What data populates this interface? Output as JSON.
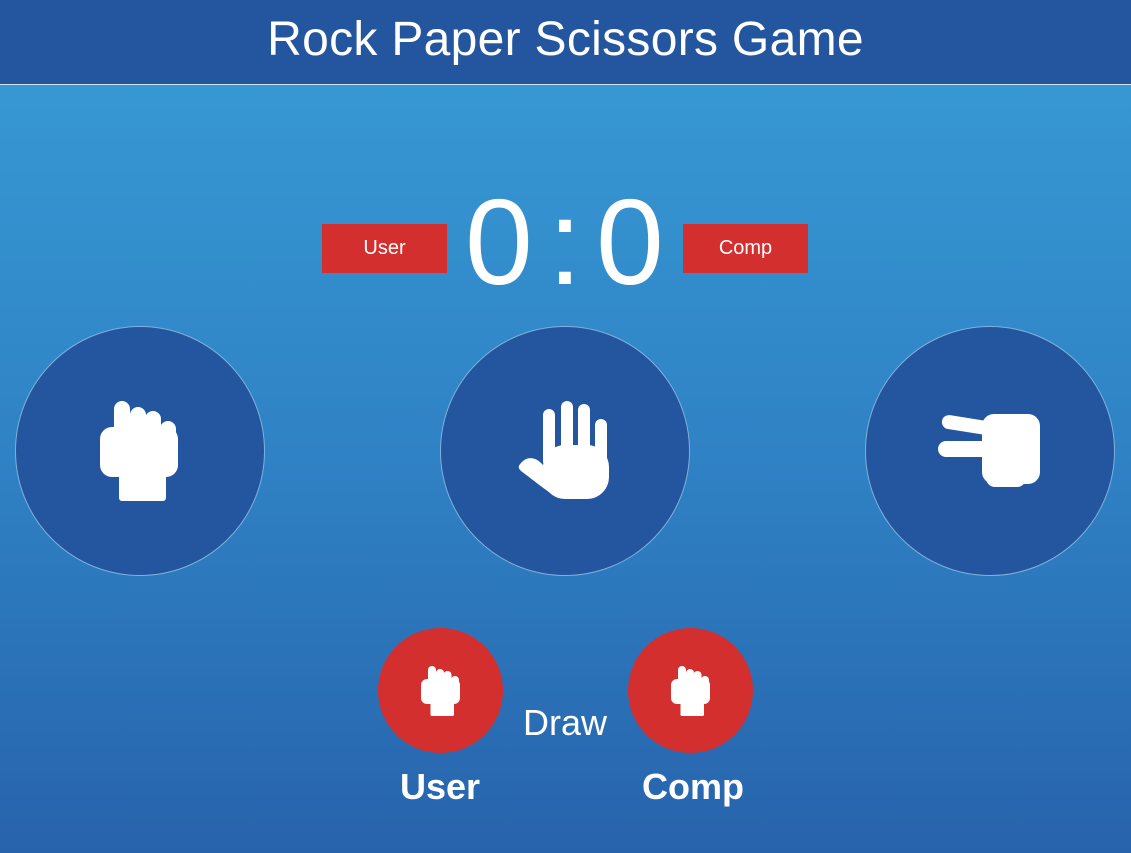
{
  "header": {
    "title": "Rock Paper Scissors Game"
  },
  "scoreboard": {
    "user_label": "User",
    "comp_label": "Comp",
    "user_score": "0",
    "separator": ":",
    "comp_score": "0"
  },
  "choices": [
    {
      "id": "rock",
      "icon": "hand-rock-icon"
    },
    {
      "id": "paper",
      "icon": "hand-paper-icon"
    },
    {
      "id": "scissors",
      "icon": "hand-scissors-icon"
    }
  ],
  "result": {
    "user_choice_icon": "hand-rock-icon",
    "comp_choice_icon": "hand-rock-icon",
    "message": "Draw",
    "user_label": "User",
    "comp_label": "Comp"
  },
  "colors": {
    "header_bg": "#24559f",
    "badge_red": "#d32f2f",
    "circle_bg": "#24559f",
    "bg_top": "#389dd6",
    "bg_bottom": "#2763ac"
  }
}
